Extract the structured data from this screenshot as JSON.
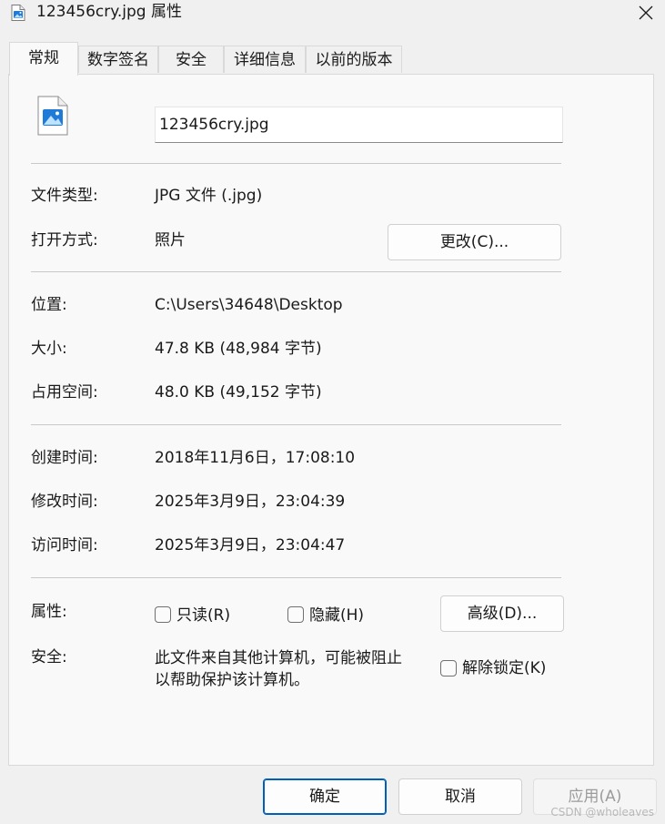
{
  "window": {
    "title": "123456cry.jpg 属性",
    "close_icon": "close-icon"
  },
  "tabs": [
    {
      "label": "常规",
      "active": true
    },
    {
      "label": "数字签名",
      "active": false
    },
    {
      "label": "安全",
      "active": false
    },
    {
      "label": "详细信息",
      "active": false
    },
    {
      "label": "以前的版本",
      "active": false
    }
  ],
  "general": {
    "file_icon": "image-file-icon",
    "file_name": "123456cry.jpg",
    "file_type_label": "文件类型:",
    "file_type_value": "JPG 文件 (.jpg)",
    "opens_with_label": "打开方式:",
    "opens_with_value": "照片",
    "change_button": "更改(C)...",
    "location_label": "位置:",
    "location_value": "C:\\Users\\34648\\Desktop",
    "size_label": "大小:",
    "size_value": "47.8 KB (48,984 字节)",
    "size_on_disk_label": "占用空间:",
    "size_on_disk_value": "48.0 KB (49,152 字节)",
    "created_label": "创建时间:",
    "created_value": "2018年11月6日，17:08:10",
    "modified_label": "修改时间:",
    "modified_value": "2025年3月9日，23:04:39",
    "accessed_label": "访问时间:",
    "accessed_value": "2025年3月9日，23:04:47",
    "attributes_label": "属性:",
    "readonly_label": "只读(R)",
    "readonly_checked": false,
    "hidden_label": "隐藏(H)",
    "hidden_checked": false,
    "advanced_button": "高级(D)...",
    "security_label": "安全:",
    "security_text_line1": "此文件来自其他计算机，可能被阻止",
    "security_text_line2": "以帮助保护该计算机。",
    "unblock_label": "解除锁定(K)",
    "unblock_checked": false
  },
  "footer": {
    "ok_button": "确定",
    "cancel_button": "取消",
    "apply_button": "应用(A)"
  },
  "watermark": "CSDN @wholeaves",
  "colors": {
    "accent": "#005fb8",
    "panel_bg": "#f9f9f9",
    "window_bg": "#f0f0f0",
    "divider": "#c8c8c8"
  }
}
